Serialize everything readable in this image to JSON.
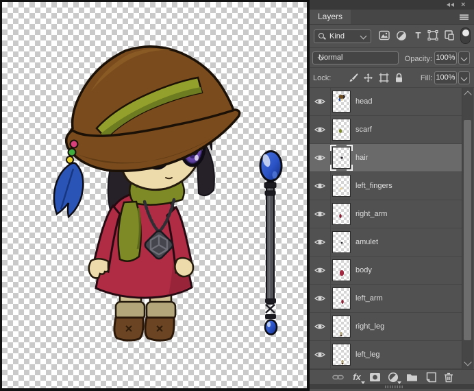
{
  "window": {
    "collapse_button": "collapse-to-icons",
    "close_button": "close"
  },
  "panel": {
    "tab_label": "Layers",
    "filter_row": {
      "search_label": "Kind",
      "type_filter_glyph": "T",
      "filter_icons": [
        "pixel-layers-filter",
        "adjustment-layers-filter",
        "type-layers-filter",
        "shape-layers-filter",
        "smart-objects-filter"
      ],
      "filter_toggle": "filtering-on"
    },
    "blend_row": {
      "blend_mode": "Normal",
      "opacity_label": "Opacity:",
      "opacity_value": "100%"
    },
    "lock_row": {
      "lock_label": "Lock:",
      "lock_icons": [
        "lock-transparent-pixels",
        "lock-image-pixels",
        "lock-position",
        "lock-artboard",
        "lock-all"
      ],
      "fill_label": "Fill:",
      "fill_value": "100%"
    },
    "layers": [
      {
        "name": "head",
        "visible": true,
        "selected": false
      },
      {
        "name": "scarf",
        "visible": true,
        "selected": false
      },
      {
        "name": "hair",
        "visible": true,
        "selected": true
      },
      {
        "name": "left_fingers",
        "visible": true,
        "selected": false
      },
      {
        "name": "right_arm",
        "visible": true,
        "selected": false
      },
      {
        "name": "amulet",
        "visible": true,
        "selected": false
      },
      {
        "name": "body",
        "visible": true,
        "selected": false
      },
      {
        "name": "left_arm",
        "visible": true,
        "selected": false
      },
      {
        "name": "right_leg",
        "visible": true,
        "selected": false
      },
      {
        "name": "left_leg",
        "visible": true,
        "selected": false
      }
    ],
    "footer": {
      "fx_label": "fx",
      "icons": [
        "link-layers",
        "layer-style-fx",
        "add-layer-mask",
        "new-adjustment-layer",
        "new-group",
        "new-layer",
        "delete-layer"
      ]
    }
  },
  "canvas": {
    "content": "chibi witch character with staff on transparency checkerboard"
  },
  "colors": {
    "panel_bg": "#515151",
    "selected_row": "#6a6a6a",
    "checker_gray": "#cacaca",
    "dress_red": "#b02b44",
    "scarf_olive": "#7d8a26",
    "hat_brown": "#7a4c1d",
    "orb_blue": "#2b53c6",
    "eye_purple": "#7852c2"
  }
}
